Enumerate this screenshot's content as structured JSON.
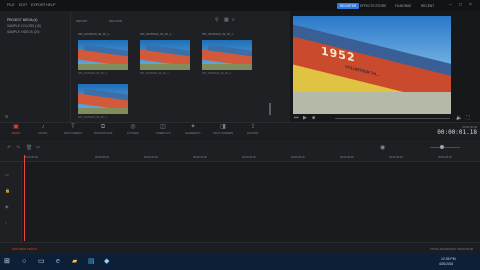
{
  "menu": {
    "items": [
      "FILE",
      "EDIT",
      "EXPORT",
      "HELP"
    ],
    "right_buttons": [
      "REGISTER",
      "EFFECTS STORE",
      "FILMORA9",
      "RECENT",
      "FULL SCREEN",
      "EXPORT"
    ]
  },
  "library": {
    "folders": [
      "PROJECT MEDIA (4)",
      "SAMPLE COLORS (15)",
      "SAMPLE VIDEOS (20)"
    ]
  },
  "media": {
    "toolbar": {
      "import": "IMPORT",
      "record": "RECORD"
    },
    "clips": [
      {
        "name": "WP_20150420_09_06_1...",
        "sub": "WP_20150420_09_06_1..."
      },
      {
        "name": "WP_20150420_09_06_1...",
        "sub": "WP_20150420_09_06_1..."
      },
      {
        "name": "WP_20150420_09_06_1...",
        "sub": "WP_20150420_09_06_1..."
      },
      {
        "name": "WP_20150420_09_06_1...",
        "sub": "WP_20150420_09_06_1..."
      }
    ]
  },
  "preview": {
    "banner_text": "1952",
    "banner_sub": "VOLUNTEER TH..."
  },
  "tools": [
    "MEDIA",
    "MUSIC",
    "TEXT/CREDIT",
    "TRANSITIONS",
    "FILTERS",
    "OVERLAYS",
    "ELEMENTS",
    "SPLIT SCREEN",
    "EXPORT"
  ],
  "timecode": {
    "label": "00:00:00:00",
    "value": "00:00:01.18"
  },
  "ruler_ticks": [
    "00:00:00:00",
    "00:00:05:00",
    "00:00:10:00",
    "00:00:15:00",
    "00:00:20:00",
    "00:00:25:00",
    "00:00:30:00",
    "00:00:35:00",
    "00:00:40:00",
    "00:00:45:00"
  ],
  "bottom": {
    "left": "ADD NEW TRACK",
    "right": "TOTAL DURATION: 00:00:00:00"
  },
  "taskbar": {
    "time": "12:35 PM",
    "date": "4/20/2016"
  }
}
